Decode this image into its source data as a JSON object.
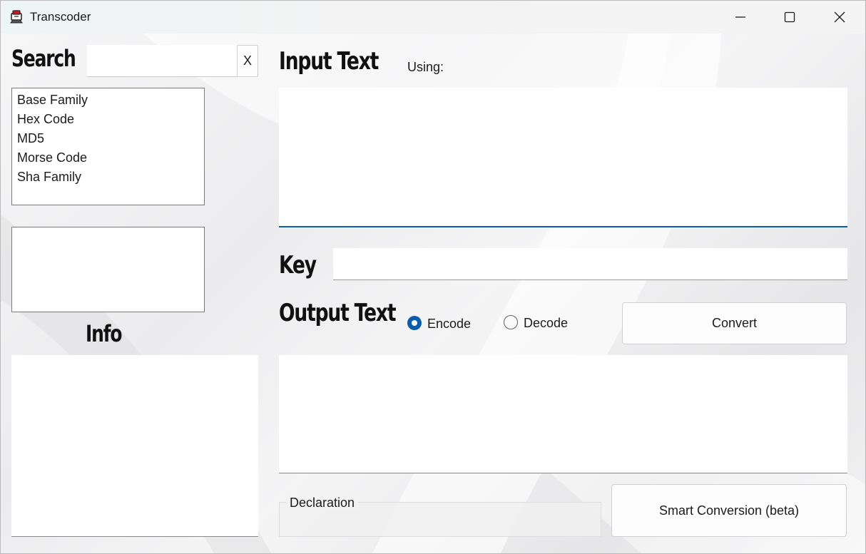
{
  "window": {
    "title": "Transcoder",
    "icon": "transcoder-app-icon"
  },
  "controls": {
    "minimize": "minimize-icon",
    "maximize": "maximize-icon",
    "close": "close-icon"
  },
  "sidebar": {
    "search_label": "Search",
    "search_value": "",
    "clear_button": "X",
    "algorithms": [
      "Base Family",
      "Hex Code",
      "MD5",
      "Morse Code",
      "Sha Family"
    ],
    "info_label": "Info"
  },
  "main": {
    "input_label": "Input Text",
    "using_label": "Using:",
    "input_value": "",
    "key_label": "Key",
    "key_value": "",
    "output_label": "Output Text",
    "mode_options": [
      {
        "label": "Encode",
        "selected": true
      },
      {
        "label": "Decode",
        "selected": false
      }
    ],
    "convert_button": "Convert",
    "output_value": "",
    "declaration_label": "Declaration",
    "smart_button": "Smart Conversion (beta)"
  },
  "colors": {
    "accent": "#0b5cad"
  }
}
